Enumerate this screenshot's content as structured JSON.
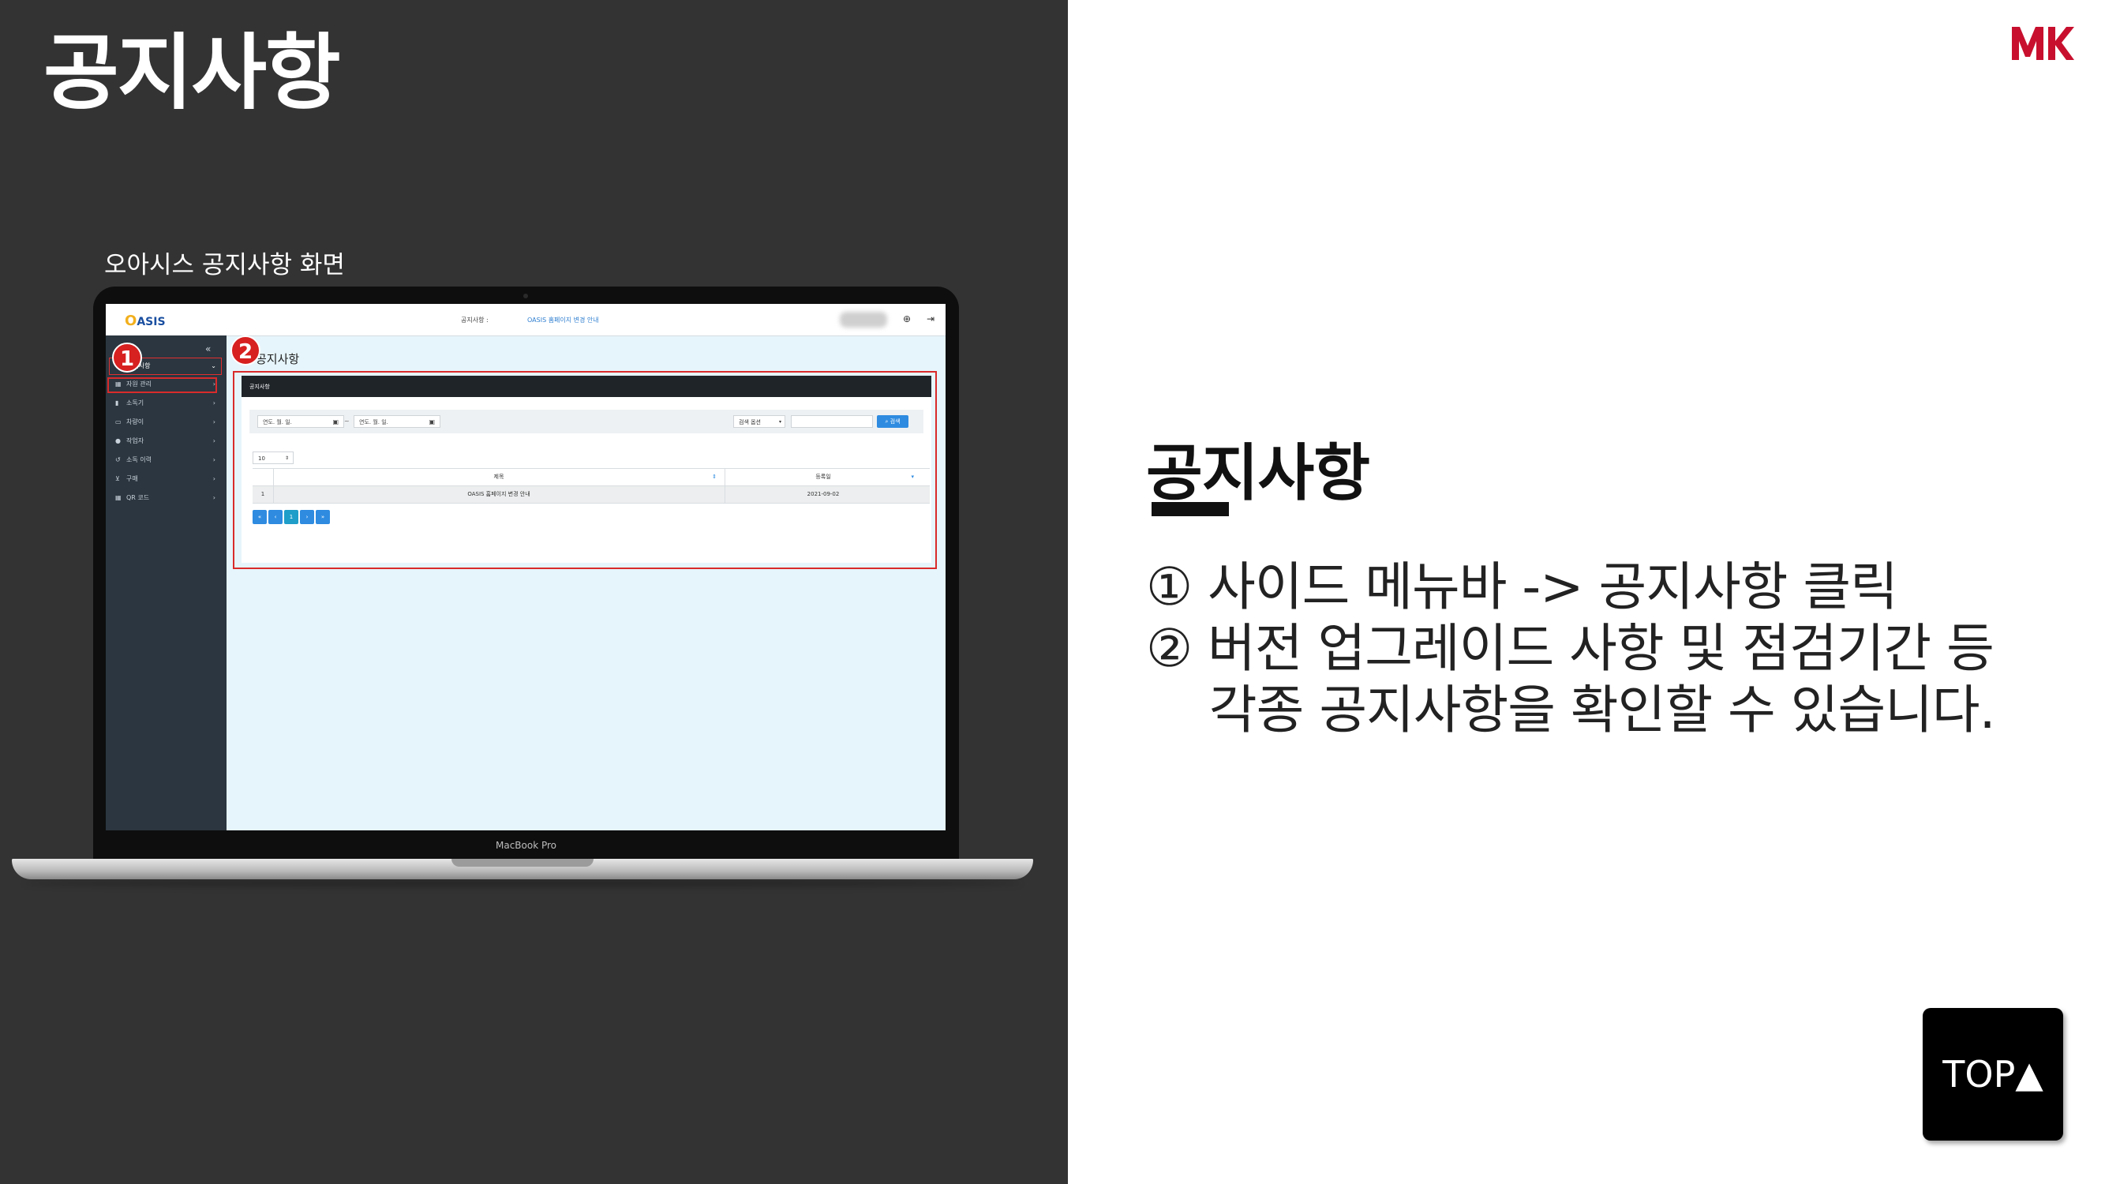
{
  "slide": {
    "title": "공지사항",
    "screen_caption": "오아시스 공지사항 화면",
    "laptop_label": "MacBook Pro"
  },
  "app": {
    "logo_letter": "O",
    "logo_rest": "ASIS",
    "nav_label": "공지사항 :",
    "nav_link": "OASIS 홈페이지 변경 안내",
    "sidebar": {
      "collapse_icon": "double-chevron-left-icon",
      "items": [
        {
          "icon": "megaphone-icon",
          "label": "공지사항",
          "active": true
        },
        {
          "icon": "grid-icon",
          "label": "자원 관리"
        },
        {
          "icon": "cylinder-icon",
          "label": "소독기"
        },
        {
          "icon": "car-icon",
          "label": "차량이"
        },
        {
          "icon": "user-icon",
          "label": "작업자"
        },
        {
          "icon": "history-icon",
          "label": "소독 이력"
        },
        {
          "icon": "cart-icon",
          "label": "구매"
        },
        {
          "icon": "qr-icon",
          "label": "QR 코드"
        }
      ]
    },
    "content_title": "공지사항",
    "panel_header": "공지사항",
    "filters": {
      "date_from_placeholder": "연도. 월. 일.",
      "date_to_placeholder": "연도. 월. 일.",
      "date_separator": "~",
      "search_option": "검색 옵션",
      "search_button": "검색"
    },
    "page_size": "10",
    "table": {
      "columns": [
        "",
        "제목",
        "등록일"
      ],
      "rows": [
        {
          "no": "1",
          "title": "OASIS 홈페이지 변경 안내",
          "date": "2021-09-02"
        }
      ]
    },
    "pagination": [
      "«",
      "‹",
      "1",
      "›",
      "»"
    ]
  },
  "badges": [
    "1",
    "2"
  ],
  "brand": {
    "logo_text": "MK",
    "colors": {
      "m": "#c8102e",
      "k": "#c8102e"
    }
  },
  "description": {
    "title": "공지사항",
    "lines": [
      "① 사이드 메뉴바 -> 공지사항 클릭",
      "② 버전 업그레이드 사항 및 점검기간 등",
      "    각종 공지사항을 확인할 수 있습니다."
    ]
  },
  "top_button": "TOP▲",
  "colors": {
    "left_bg": "#333333",
    "accent_red": "#d72020",
    "button_blue": "#2e8be0",
    "sidebar_bg": "#2b3640"
  }
}
